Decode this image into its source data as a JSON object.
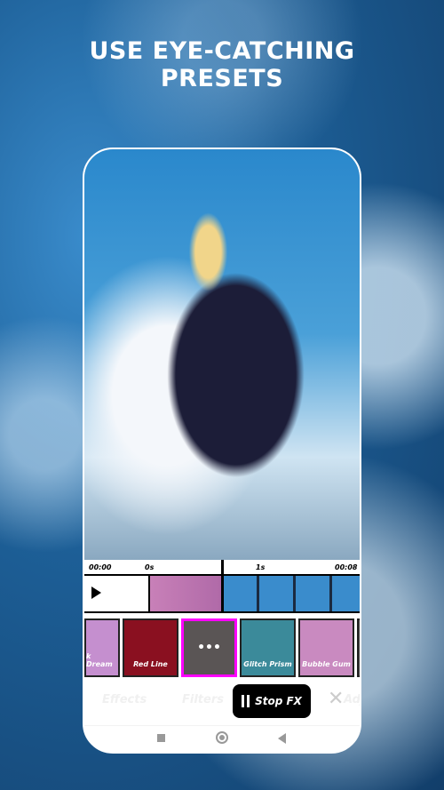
{
  "headline": [
    "USE EYE-CATCHING",
    "PRESETS"
  ],
  "timeline": {
    "start": "00:00",
    "mark0": "0s",
    "mark1": "1s",
    "end": "00:08"
  },
  "presets": [
    {
      "label": "k Dream",
      "color": "#c58fcf"
    },
    {
      "label": "Red Line",
      "color": "#8a1020"
    },
    {
      "label": "•••",
      "color": "#5a5555",
      "selected": true
    },
    {
      "label": "Glitch Prism",
      "color": "#3b8a9a"
    },
    {
      "label": "Bubble Gum",
      "color": "#c98ac0"
    },
    {
      "label": "",
      "color": "#444"
    }
  ],
  "tabs": {
    "effects": "Effects",
    "filters": "Filters",
    "adjust": "Adj"
  },
  "stop_fx": "Stop FX",
  "accent": "#ff00ff"
}
